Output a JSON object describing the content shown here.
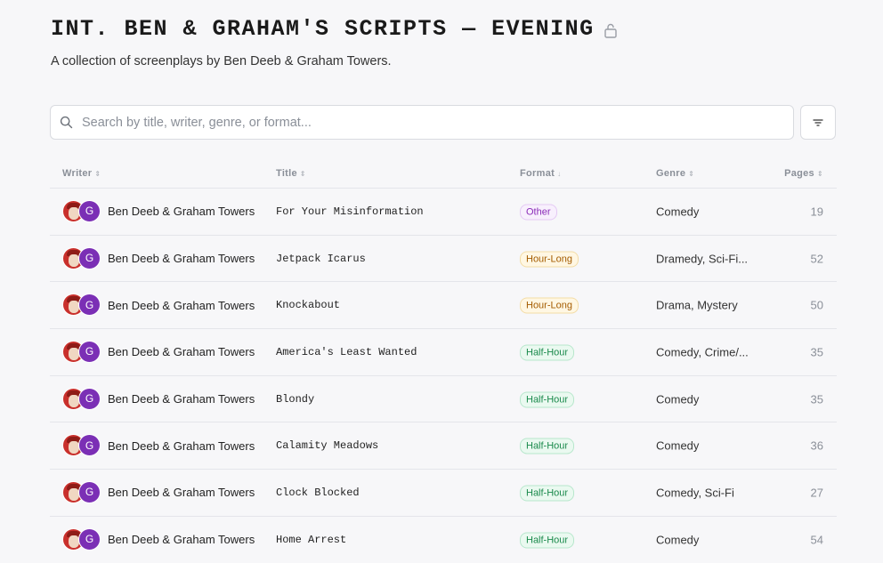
{
  "header": {
    "title": "INT. BEN & GRAHAM'S SCRIPTS — EVENING",
    "subtitle": "A collection of screenplays by Ben Deeb & Graham Towers.",
    "lock_icon": "lock-open-icon"
  },
  "search": {
    "placeholder": "Search by title, writer, genre, or format...",
    "value": "",
    "icon": "search-icon"
  },
  "filter_button": {
    "icon": "filter-icon"
  },
  "table": {
    "columns": [
      "Writer",
      "Title",
      "Format",
      "Genre",
      "Pages"
    ],
    "rows": [
      {
        "writer": "Ben Deeb & Graham Towers",
        "avatar2": "G",
        "title": "For Your Misinformation",
        "format": "Other",
        "format_type": "other",
        "genre": "Comedy",
        "pages": "19"
      },
      {
        "writer": "Ben Deeb & Graham Towers",
        "avatar2": "G",
        "title": "Jetpack Icarus",
        "format": "Hour-Long",
        "format_type": "hour",
        "genre": "Dramedy, Sci-Fi...",
        "pages": "52"
      },
      {
        "writer": "Ben Deeb & Graham Towers",
        "avatar2": "G",
        "title": "Knockabout",
        "format": "Hour-Long",
        "format_type": "hour",
        "genre": "Drama, Mystery",
        "pages": "50"
      },
      {
        "writer": "Ben Deeb & Graham Towers",
        "avatar2": "G",
        "title": "America's Least Wanted",
        "format": "Half-Hour",
        "format_type": "half",
        "genre": "Comedy, Crime/...",
        "pages": "35"
      },
      {
        "writer": "Ben Deeb & Graham Towers",
        "avatar2": "G",
        "title": "Blondy",
        "format": "Half-Hour",
        "format_type": "half",
        "genre": "Comedy",
        "pages": "35"
      },
      {
        "writer": "Ben Deeb & Graham Towers",
        "avatar2": "G",
        "title": "Calamity Meadows",
        "format": "Half-Hour",
        "format_type": "half",
        "genre": "Comedy",
        "pages": "36"
      },
      {
        "writer": "Ben Deeb & Graham Towers",
        "avatar2": "G",
        "title": "Clock Blocked",
        "format": "Half-Hour",
        "format_type": "half",
        "genre": "Comedy, Sci-Fi",
        "pages": "27"
      },
      {
        "writer": "Ben Deeb & Graham Towers",
        "avatar2": "G",
        "title": "Home Arrest",
        "format": "Half-Hour",
        "format_type": "half",
        "genre": "Comedy",
        "pages": "54"
      }
    ]
  }
}
